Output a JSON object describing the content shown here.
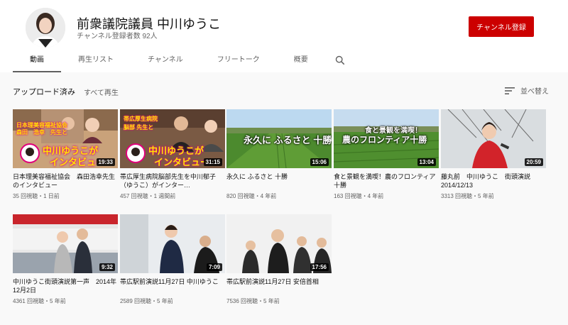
{
  "channel": {
    "name": "前衆議院議員 中川ゆうこ",
    "subscribers": "チャンネル登録者数 92人",
    "subscribe_label": "チャンネル登録"
  },
  "tabs": [
    {
      "label": "動画",
      "active": true
    },
    {
      "label": "再生リスト",
      "active": false
    },
    {
      "label": "チャンネル",
      "active": false
    },
    {
      "label": "フリートーク",
      "active": false
    },
    {
      "label": "概要",
      "active": false
    }
  ],
  "section": {
    "title": "アップロード済み",
    "play_all": "すべて再生",
    "sort_label": "並べ替え"
  },
  "videos": [
    {
      "title": "日本理美容福祉協会　森田浩幸先生のインタビュー",
      "meta": "35 回視聴・1 日前",
      "duration": "19:33",
      "overlay": [
        "日本理美容福祉協会",
        "森田　浩幸　先生と",
        "中川ゆうこが",
        "インタビュー"
      ]
    },
    {
      "title": "帯広厚生病院脳部先生を中川郁子（ゆうこ）がインター…",
      "meta": "457 回視聴・1 週間前",
      "duration": "31:15",
      "overlay": [
        "帯広厚生病院",
        "脳部 先生と",
        "中川ゆうこが",
        "インタビュー"
      ]
    },
    {
      "title": "永久に ふるさと 十勝",
      "meta": "820 回視聴・4 年前",
      "duration": "15:06",
      "overlay": [
        "永久に ふるさと 十勝"
      ]
    },
    {
      "title": "食と景観を満喫！農のフロンティア十勝",
      "meta": "163 回視聴・4 年前",
      "duration": "13:04",
      "overlay": [
        "食と景観を満喫！",
        "農のフロンティア十勝"
      ]
    },
    {
      "title": "藤丸前　中川ゆうこ　街頭演説　2014/12/13",
      "meta": "3313 回視聴・5 年前",
      "duration": "20:59",
      "overlay": []
    },
    {
      "title": "中川ゆうこ街頭演説第一声　2014年12月2日",
      "meta": "4361 回視聴・5 年前",
      "duration": "9:32",
      "overlay": []
    },
    {
      "title": "帯広駅前演説11月27日 中川ゆうこ",
      "meta": "2589 回視聴・5 年前",
      "duration": "7:09",
      "overlay": []
    },
    {
      "title": "帯広駅前演説11月27日 安倍首相",
      "meta": "7536 回視聴・5 年前",
      "duration": "17:56",
      "overlay": []
    }
  ],
  "colors": {
    "subscribe": "#cc0000",
    "overlay_yellow": "#ffe600",
    "overlay_magenta": "#e0007a"
  }
}
